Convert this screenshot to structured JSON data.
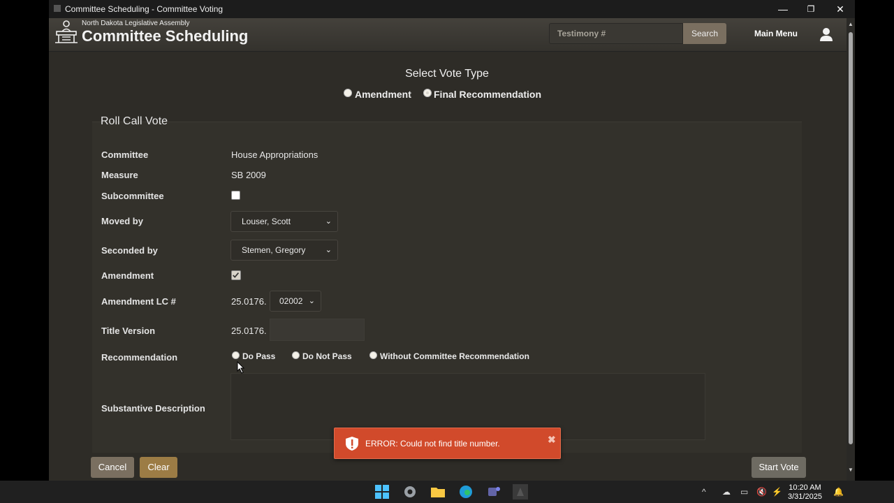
{
  "window": {
    "title": "Committee Scheduling - Committee Voting",
    "minimize": "—",
    "restore": "❐",
    "close": "✕"
  },
  "header": {
    "org": "North Dakota Legislative Assembly",
    "app_title": "Committee Scheduling",
    "search_placeholder": "Testimony #",
    "search_label": "Search",
    "main_menu": "Main Menu"
  },
  "vote_type": {
    "heading": "Select Vote Type",
    "options": [
      "Amendment",
      "Final Recommendation"
    ],
    "selected": "Final Recommendation"
  },
  "form": {
    "title": "Roll Call Vote",
    "labels": {
      "committee": "Committee",
      "measure": "Measure",
      "subcommittee": "Subcommittee",
      "moved_by": "Moved by",
      "seconded_by": "Seconded by",
      "amendment": "Amendment",
      "amendment_lc": "Amendment LC #",
      "title_version": "Title Version",
      "recommendation": "Recommendation",
      "substantive_description": "Substantive Description"
    },
    "committee": "House Appropriations",
    "measure": "SB 2009",
    "subcommittee_checked": false,
    "moved_by": "Louser, Scott",
    "seconded_by": "Stemen, Gregory",
    "amendment_checked": true,
    "amendment_lc_prefix": "25.0176.",
    "amendment_lc_value": "02002",
    "title_version_prefix": "25.0176.",
    "title_version_value": "",
    "recommendation_options": [
      "Do Pass",
      "Do Not Pass",
      "Without Committee Recommendation"
    ],
    "substantive_description": ""
  },
  "buttons": {
    "cancel": "Cancel",
    "clear": "Clear",
    "start_vote": "Start Vote"
  },
  "error": {
    "message": "ERROR: Could not find title number.",
    "close": "✖"
  },
  "colors": {
    "background": "#2e2c27",
    "error": "#d14a2b",
    "cancel": "#7a6f60",
    "clear": "#9c7c45",
    "start_vote": "#6e6b62"
  },
  "taskbar": {
    "time": "10:20 AM",
    "date": "3/31/2025"
  }
}
